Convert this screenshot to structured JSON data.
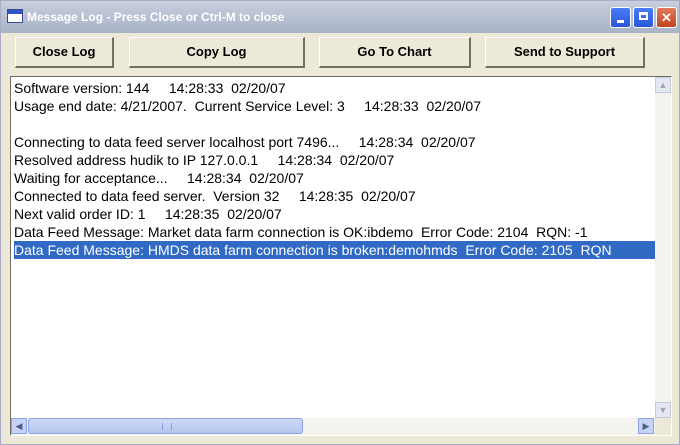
{
  "window": {
    "title": "Message Log - Press Close or Ctrl-M to close",
    "min_glyph": "",
    "max_glyph": "",
    "close_glyph": "✕"
  },
  "toolbar": {
    "close_log": "Close Log",
    "copy_log": "Copy Log",
    "go_to_chart": "Go To Chart",
    "send_to_support": "Send to Support"
  },
  "log": {
    "lines": [
      "Software version: 144     14:28:33  02/20/07",
      "Usage end date: 4/21/2007.  Current Service Level: 3     14:28:33  02/20/07",
      "",
      "Connecting to data feed server localhost port 7496...     14:28:34  02/20/07",
      "Resolved address hudik to IP 127.0.0.1     14:28:34  02/20/07",
      "Waiting for acceptance...     14:28:34  02/20/07",
      "Connected to data feed server.  Version 32     14:28:35  02/20/07",
      "Next valid order ID: 1     14:28:35  02/20/07",
      "Data Feed Message: Market data farm connection is OK:ibdemo  Error Code: 2104  RQN: -1",
      "Data Feed Message: HMDS data farm connection is broken:demohmds  Error Code: 2105  RQN"
    ],
    "selected_index": 9
  },
  "scrollbars": {
    "up": "▲",
    "down": "▼",
    "left": "◀",
    "right": "▶"
  },
  "colors": {
    "selection": "#316ac5",
    "window_face": "#ece9d8"
  }
}
